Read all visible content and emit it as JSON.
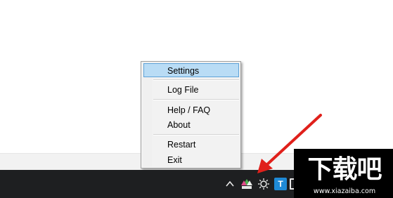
{
  "context_menu": {
    "items": [
      {
        "label": "Settings",
        "selected": true
      },
      {
        "label": "Log File"
      },
      {
        "label": "Help / FAQ"
      },
      {
        "label": "About"
      },
      {
        "label": "Restart"
      },
      {
        "label": "Exit"
      }
    ]
  },
  "taskbar": {
    "tray_icons": [
      "chevron-up-icon",
      "app-tray-icon",
      "brightness-icon",
      "t-app-icon",
      "network-icon"
    ],
    "t_icon_letter": "T"
  },
  "watermark": {
    "title": "下载吧",
    "url": "www.xiazaiba.com"
  },
  "colors": {
    "menu_selection": "#b9dcf5",
    "menu_selection_border": "#5ea2d8",
    "taskbar": "#1e1f21",
    "annotation_arrow": "#e0201b"
  }
}
